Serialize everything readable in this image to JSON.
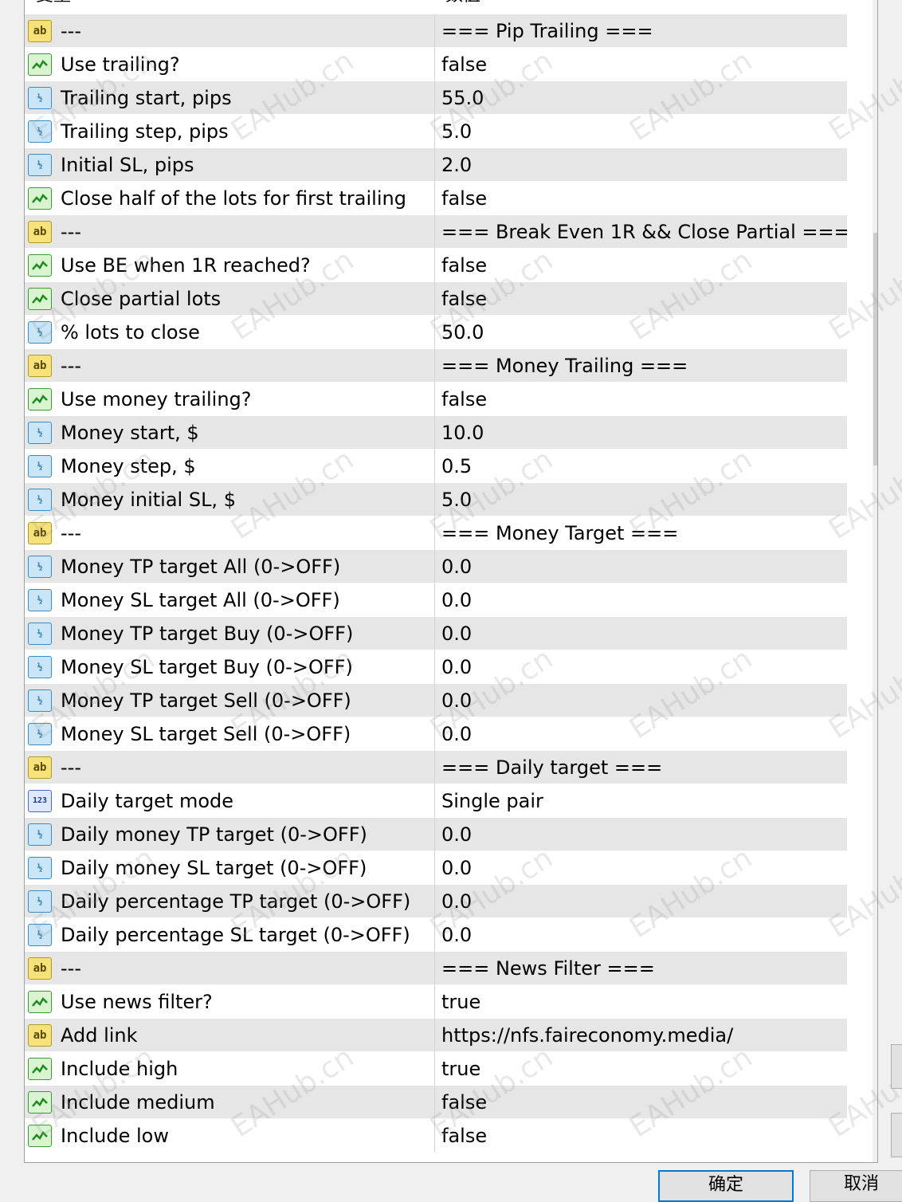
{
  "header": {
    "name_col": "变量",
    "value_col": "数值"
  },
  "rows": [
    {
      "icon": "ab",
      "name": "---",
      "value": "=== Pip Trailing ==="
    },
    {
      "icon": "bool",
      "name": "Use trailing?",
      "value": "false"
    },
    {
      "icon": "dbl",
      "name": "Trailing start, pips",
      "value": "55.0"
    },
    {
      "icon": "dbl",
      "name": "Trailing step, pips",
      "value": "5.0"
    },
    {
      "icon": "dbl",
      "name": "Initial SL, pips",
      "value": "2.0"
    },
    {
      "icon": "bool",
      "name": "Close half of the lots for first trailing",
      "value": "false"
    },
    {
      "icon": "ab",
      "name": "---",
      "value": "=== Break Even 1R && Close Partial ==="
    },
    {
      "icon": "bool",
      "name": "Use BE when 1R reached?",
      "value": "false"
    },
    {
      "icon": "bool",
      "name": "Close partial lots",
      "value": "false"
    },
    {
      "icon": "dbl",
      "name": "% lots to close",
      "value": "50.0"
    },
    {
      "icon": "ab",
      "name": "---",
      "value": "=== Money Trailing ==="
    },
    {
      "icon": "bool",
      "name": "Use money trailing?",
      "value": "false"
    },
    {
      "icon": "dbl",
      "name": "Money start, $",
      "value": "10.0"
    },
    {
      "icon": "dbl",
      "name": "Money step, $",
      "value": "0.5"
    },
    {
      "icon": "dbl",
      "name": "Money initial SL, $",
      "value": "5.0"
    },
    {
      "icon": "ab",
      "name": "---",
      "value": "=== Money Target ==="
    },
    {
      "icon": "dbl",
      "name": "Money TP target All (0->OFF)",
      "value": "0.0"
    },
    {
      "icon": "dbl",
      "name": "Money SL target All (0->OFF)",
      "value": "0.0"
    },
    {
      "icon": "dbl",
      "name": "Money TP target Buy (0->OFF)",
      "value": "0.0"
    },
    {
      "icon": "dbl",
      "name": "Money SL target Buy (0->OFF)",
      "value": "0.0"
    },
    {
      "icon": "dbl",
      "name": "Money TP target Sell (0->OFF)",
      "value": "0.0"
    },
    {
      "icon": "dbl",
      "name": "Money SL target Sell (0->OFF)",
      "value": "0.0"
    },
    {
      "icon": "ab",
      "name": "---",
      "value": "=== Daily target ==="
    },
    {
      "icon": "enum",
      "name": "Daily target mode",
      "value": "Single pair"
    },
    {
      "icon": "dbl",
      "name": "Daily money TP target (0->OFF)",
      "value": "0.0"
    },
    {
      "icon": "dbl",
      "name": "Daily money SL target (0->OFF)",
      "value": "0.0"
    },
    {
      "icon": "dbl",
      "name": "Daily percentage TP target (0->OFF)",
      "value": "0.0"
    },
    {
      "icon": "dbl",
      "name": "Daily percentage SL target (0->OFF)",
      "value": "0.0"
    },
    {
      "icon": "ab",
      "name": "---",
      "value": "=== News Filter ==="
    },
    {
      "icon": "bool",
      "name": "Use news filter?",
      "value": "true"
    },
    {
      "icon": "ab",
      "name": "Add link",
      "value": "https://nfs.faireconomy.media/"
    },
    {
      "icon": "bool",
      "name": "Include high",
      "value": "true"
    },
    {
      "icon": "bool",
      "name": "Include medium",
      "value": "false"
    },
    {
      "icon": "bool",
      "name": "Include low",
      "value": "false"
    }
  ],
  "icon_labels": {
    "ab": "ab",
    "dbl": "½",
    "enum": "123"
  },
  "scroll": {
    "position": 0.2,
    "visible_fraction": 0.2
  },
  "watermark": "EAHub.cn",
  "buttons": {
    "ok_label": "确定",
    "cancel_label": "取消"
  },
  "colors": {
    "row_alt": "#e6e6e6",
    "accent": "#0078d7"
  }
}
